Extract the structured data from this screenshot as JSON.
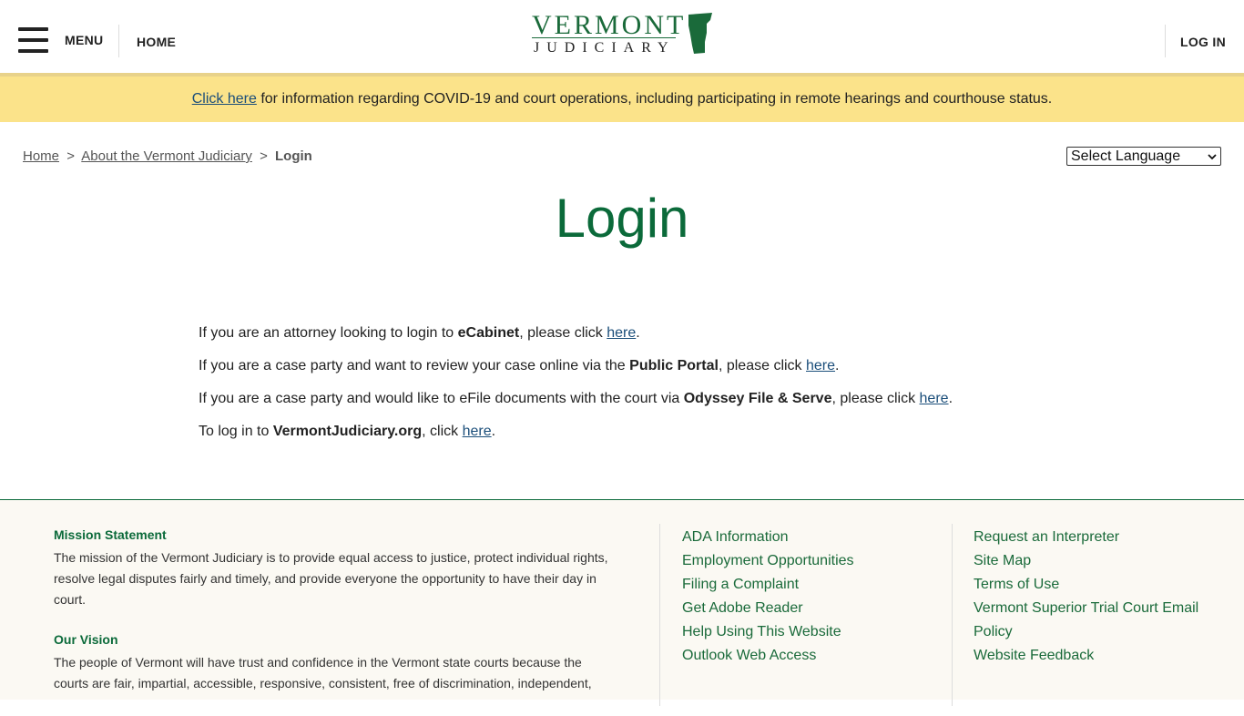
{
  "header": {
    "menu_label": "MENU",
    "home_label": "HOME",
    "login_label": "LOG IN",
    "logo_top": "VERMONT",
    "logo_bottom": "JUDICIARY",
    "logo_color": "#1a6a3a"
  },
  "alert": {
    "link_text": "Click here",
    "text": " for information regarding COVID-19 and court operations, including participating in remote hearings and courthouse status.",
    "background": "#fbe38a"
  },
  "breadcrumb": {
    "home": "Home",
    "sep1": ">",
    "about": "About the Vermont Judiciary",
    "sep2": ">",
    "current": "Login"
  },
  "language": {
    "selected": "Select Language"
  },
  "page": {
    "title": "Login",
    "title_color": "#0b6a3a"
  },
  "content": {
    "line1_pre": "If you are an attorney looking to login to ",
    "line1_bold": "eCabinet",
    "line1_mid": ", please click ",
    "line1_link": "here",
    "line1_end": ".",
    "line2_pre": "If you are a case party and want to review your case online via the ",
    "line2_bold": "Public Portal",
    "line2_mid": ", please click ",
    "line2_link": "here",
    "line2_end": ".",
    "line3_pre": "If you are a case party and would like to eFile documents with the court via ",
    "line3_bold": "Odyssey File & Serve",
    "line3_mid": ", please click ",
    "line3_link": "here",
    "line3_end": ".",
    "line4_pre": "To log in to ",
    "line4_bold": "VermontJudiciary.org",
    "line4_mid": ", click ",
    "line4_link": "here",
    "line4_end": "."
  },
  "footer": {
    "mission_title": "Mission Statement",
    "mission_text": "The mission of the Vermont Judiciary is to provide equal access to justice, protect individual rights, resolve legal disputes fairly and timely, and provide everyone the opportunity to have their day in court.",
    "vision_title": "Our Vision",
    "vision_text": "The people of Vermont will have trust and confidence in the Vermont state courts because the courts are fair, impartial, accessible, responsive, consistent, free of discrimination, independent,",
    "links_col2": [
      "ADA Information",
      "Employment Opportunities",
      "Filing a Complaint",
      "Get Adobe Reader",
      "Help Using This Website",
      "Outlook Web Access"
    ],
    "links_col3": [
      "Request an Interpreter",
      "Site Map",
      "Terms of Use",
      "Vermont Superior Trial Court Email",
      "Policy",
      "Website Feedback"
    ]
  }
}
